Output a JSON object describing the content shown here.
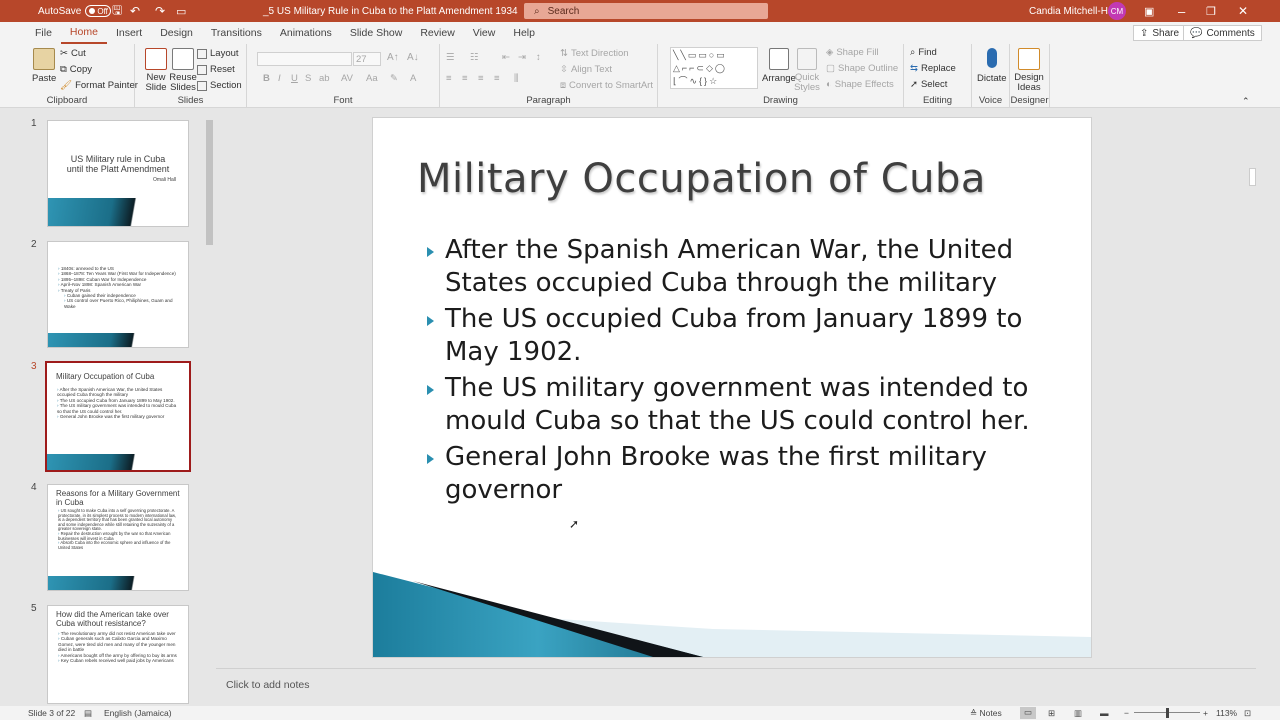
{
  "titlebar": {
    "autosave_label": "AutoSave",
    "autosave_state": "Off",
    "doc_title": "_5 US Military Rule in Cuba to the Platt Amendment 1934",
    "search_placeholder": "Search",
    "user_name": "Candia Mitchell-Hall",
    "user_initials": "CM"
  },
  "menu": {
    "tabs": [
      "File",
      "Home",
      "Insert",
      "Design",
      "Transitions",
      "Animations",
      "Slide Show",
      "Review",
      "View",
      "Help"
    ],
    "active": "Home",
    "share_label": "Share",
    "comments_label": "Comments"
  },
  "ribbon": {
    "clipboard": {
      "paste": "Paste",
      "cut": "Cut",
      "copy": "Copy",
      "format_painter": "Format Painter",
      "label": "Clipboard"
    },
    "slides": {
      "new_slide": "New Slide",
      "reuse": "Reuse Slides",
      "layout": "Layout",
      "reset": "Reset",
      "section": "Section",
      "label": "Slides"
    },
    "font": {
      "label": "Font",
      "size_value": "27"
    },
    "paragraph": {
      "text_direction": "Text Direction",
      "align_text": "Align Text",
      "smartart": "Convert to SmartArt",
      "label": "Paragraph"
    },
    "drawing": {
      "arrange": "Arrange",
      "quick_styles": "Quick Styles",
      "shape_fill": "Shape Fill",
      "shape_outline": "Shape Outline",
      "shape_effects": "Shape Effects",
      "label": "Drawing"
    },
    "editing": {
      "find": "Find",
      "replace": "Replace",
      "select": "Select",
      "label": "Editing"
    },
    "voice": {
      "dictate": "Dictate",
      "label": "Voice"
    },
    "designer": {
      "design_ideas": "Design Ideas",
      "label": "Designer"
    }
  },
  "thumbnails": [
    {
      "num": "1",
      "title": "US Military rule in Cuba until the Platt Amendment",
      "subtitle": "Omali Hall",
      "bullets": []
    },
    {
      "num": "2",
      "title": "",
      "subtitle": "",
      "bullets": [
        "1840s: annexed to the US",
        "1868–1878: Ten Years War (First War for Independence)",
        "1895–1898: Cuban War for Independence",
        "April–Nov 1898: Spanish American War",
        "Treaty of Paris",
        "Cuban gained their independence",
        "US control over Puerto Rico, Philiphines, Guam and Wake"
      ]
    },
    {
      "num": "3",
      "title": "Military Occupation of Cuba",
      "subtitle": "",
      "bullets": [
        "After the Spanish American War, the United States occupied Cuba through the military",
        "The US occupied Cuba from January 1899 to May 1902.",
        "The US military government was intended to mould Cuba so that the US could control her.",
        "General John Brooke was the first military governor"
      ]
    },
    {
      "num": "4",
      "title": "Reasons for a Military Government in Cuba",
      "subtitle": "",
      "bullets": [
        "US sought to make Cuba into a self governing protectorate. A protectorate, in its simplest process to modern international law, is a dependent territory that has been granted local autonomy and some independence while still retaining the suzerainty of a greater sovereign state.",
        "Repair the destruction wrought by the war so that American businesses will invest in Cuba",
        "Absorb Cuba into the economic sphere and influence of the United States"
      ]
    },
    {
      "num": "5",
      "title": "How did the American take over Cuba without resistance?",
      "subtitle": "",
      "bullets": [
        "The revolutionary army did not resist American take over",
        "Cuban generals such as Calixto Garcia and Maximo Gomez, were tired old men and many of the younger men died in battle",
        "Americans bought off the army by offering to buy its arms",
        "Key Cuban rebels received well paid jobs by Americans"
      ]
    }
  ],
  "slide": {
    "title": "Military Occupation of Cuba",
    "bullets": [
      "After the Spanish American War, the United States occupied Cuba through the military",
      "The US occupied Cuba from January 1899 to May 1902.",
      "The US military government was intended to mould Cuba so that the US could control her.",
      "General John Brooke was the first military governor"
    ]
  },
  "notes_placeholder": "Click to add notes",
  "status": {
    "slide_info": "Slide 3 of 22",
    "language": "English (Jamaica)",
    "notes_label": "Notes",
    "zoom": "113%"
  },
  "colors": {
    "accent": "#b7472a",
    "selection": "#9e1b1b",
    "bullet": "#2a8fb0"
  }
}
